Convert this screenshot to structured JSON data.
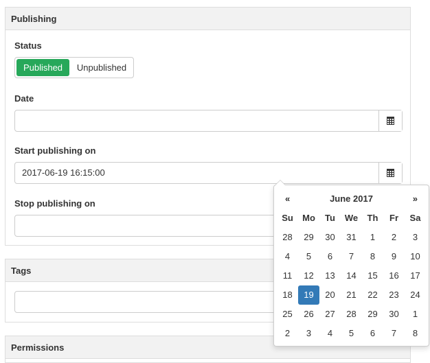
{
  "publishing": {
    "heading": "Publishing",
    "status_label": "Status",
    "status_options": [
      "Published",
      "Unpublished"
    ],
    "status_selected": "Published",
    "date_label": "Date",
    "date_value": "",
    "start_label": "Start publishing on",
    "start_value": "2017-06-19 16:15:00",
    "stop_label": "Stop publishing on",
    "stop_value": ""
  },
  "tags": {
    "heading": "Tags",
    "value": ""
  },
  "permissions": {
    "heading": "Permissions"
  },
  "datepicker": {
    "prev": "«",
    "next": "»",
    "month_title": "June 2017",
    "weekdays": [
      "Su",
      "Mo",
      "Tu",
      "We",
      "Th",
      "Fr",
      "Sa"
    ],
    "weeks": [
      [
        "28",
        "29",
        "30",
        "31",
        "1",
        "2",
        "3"
      ],
      [
        "4",
        "5",
        "6",
        "7",
        "8",
        "9",
        "10"
      ],
      [
        "11",
        "12",
        "13",
        "14",
        "15",
        "16",
        "17"
      ],
      [
        "18",
        "19",
        "20",
        "21",
        "22",
        "23",
        "24"
      ],
      [
        "25",
        "26",
        "27",
        "28",
        "29",
        "30",
        "1"
      ],
      [
        "2",
        "3",
        "4",
        "5",
        "6",
        "7",
        "8"
      ]
    ],
    "selected_day": "19",
    "selected_color": "#337ab7"
  },
  "colors": {
    "published_green": "#27a85a",
    "heading_bg": "#f2f2f2"
  },
  "icons": {
    "calendar": "calendar-icon"
  }
}
